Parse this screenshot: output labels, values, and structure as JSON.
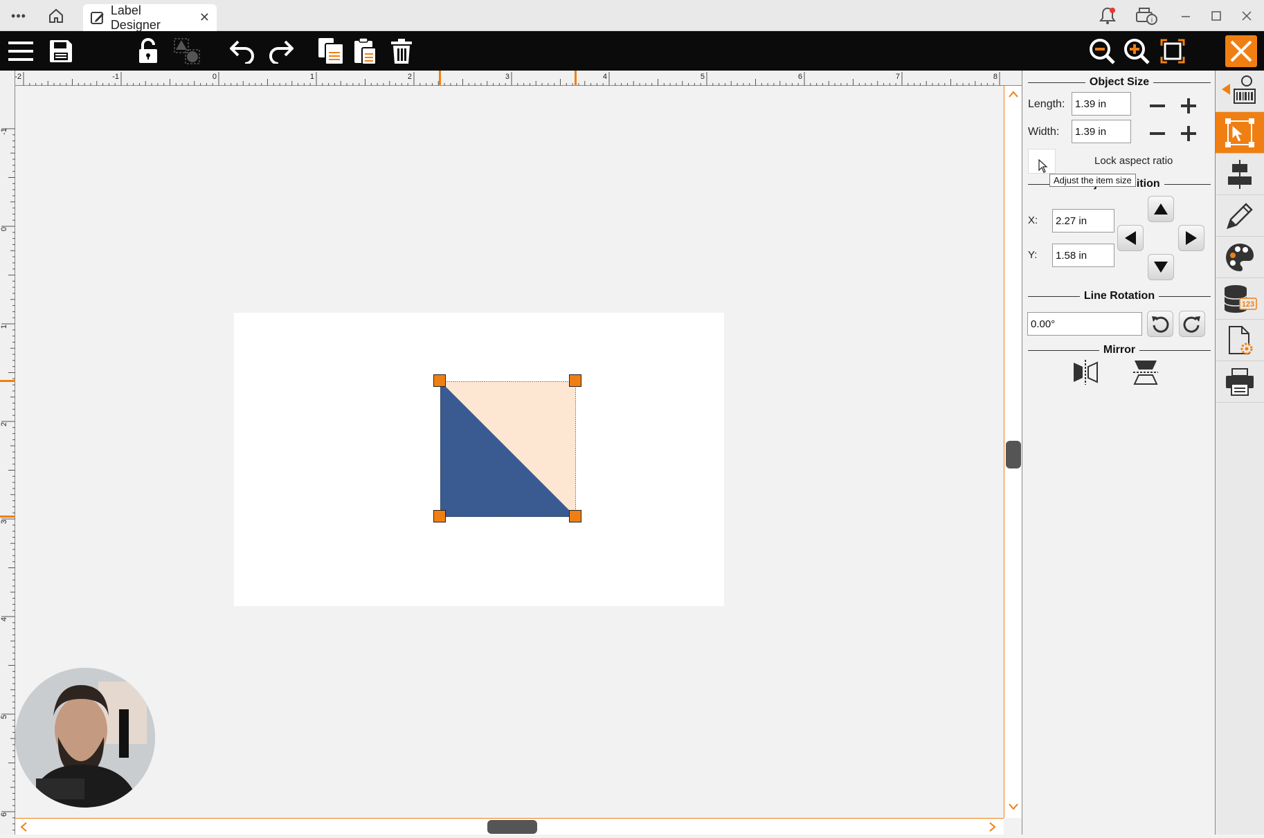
{
  "window": {
    "tab_title": "Label Designer",
    "menu_dots": "•••",
    "close_tab": "✕"
  },
  "toolbar": {
    "tools": [
      "menu-icon",
      "save-icon",
      "unlock-icon",
      "group-icon",
      "undo-icon",
      "redo-icon",
      "copy-icon",
      "paste-icon",
      "delete-icon",
      "zoom-out-icon",
      "zoom-in-icon",
      "fit-icon",
      "close-icon"
    ],
    "accent": "#f07f13"
  },
  "ruler": {
    "h_labels": [
      "-2",
      "-1",
      "0",
      "1",
      "2",
      "3",
      "4",
      "5",
      "6",
      "7",
      "8"
    ],
    "v_labels": [
      "-1",
      "0",
      "1",
      "2",
      "3",
      "4",
      "5",
      "6"
    ]
  },
  "shape": {
    "fill_primary": "#3a5a92",
    "fill_secondary": "#fde7d2"
  },
  "panel": {
    "object_size": {
      "title": "Object Size",
      "length_label": "Length:",
      "length_value": "1.39 in",
      "width_label": "Width:",
      "width_value": "1.39 in",
      "lock_label": "Lock aspect ratio",
      "lock_checked": false
    },
    "tooltip": "Adjust the item size",
    "position": {
      "title": "Object Position",
      "x_label": "X:",
      "x_value": "2.27 in",
      "y_label": "Y:",
      "y_value": "1.58 in"
    },
    "rotation": {
      "title": "Line Rotation",
      "value": "0.00°"
    },
    "mirror": {
      "title": "Mirror"
    }
  },
  "sidebar": {
    "items": [
      "barcode-icon",
      "select-size-icon",
      "align-icon",
      "pencil-icon",
      "palette-icon",
      "database-icon",
      "page-settings-icon",
      "print-icon"
    ]
  }
}
